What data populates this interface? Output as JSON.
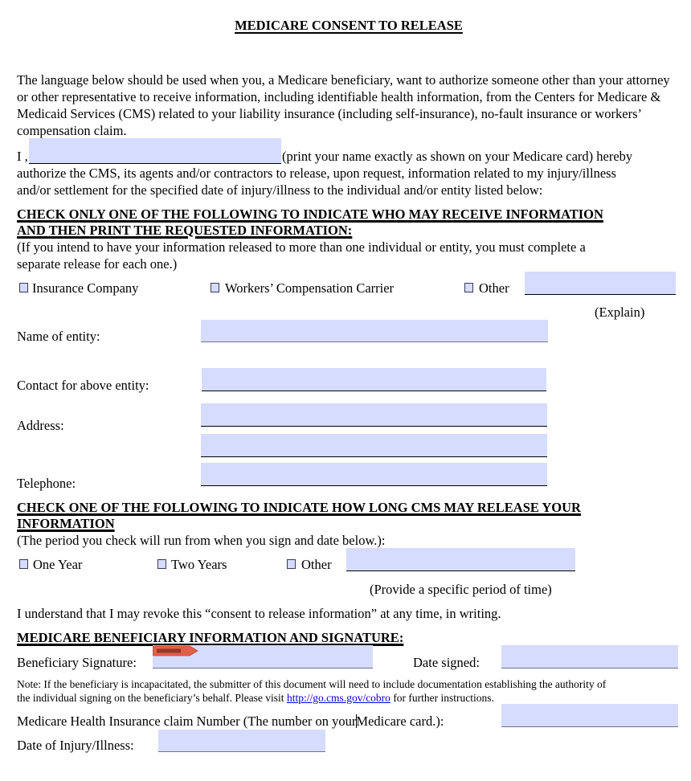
{
  "document": {
    "title": "MEDICARE CONSENT TO RELEASE",
    "intro": "The language below should be used when you, a Medicare beneficiary, want to authorize someone other than your attorney or other representative to receive information, including identifiable health information, from the Centers for Medicare & Medicaid Services (CMS) related to your liability insurance (including self-insurance), no-fault insurance or workers’ compensation claim.",
    "authorization": {
      "prefix": "I ,",
      "after_name": "(print your name exactly as shown on your Medicare card) hereby",
      "line2": "authorize the CMS, its agents and/or contractors to release, upon request, information related to my injury/illness",
      "line3": "and/or settlement for the specified date of injury/illness to the individual and/or entity listed below:",
      "name_value": ""
    },
    "section_recipient": {
      "heading_line1": "CHECK ONLY ONE OF THE FOLLOWING TO INDICATE WHO MAY RECEIVE INFORMATION",
      "heading_line2": "AND THEN PRINT THE REQUESTED INFORMATION:",
      "instructions_line1": "(If you intend to have your information released to more than one individual or entity, you must complete a",
      "instructions_line2": "separate release for each one.)",
      "options": [
        {
          "label": "Insurance Company",
          "checked": false
        },
        {
          "label": "Workers’ Compensation Carrier",
          "checked": false
        },
        {
          "label": "Other",
          "checked": false
        }
      ],
      "other_value": "",
      "other_hint": "(Explain)",
      "fields": {
        "entity_name_label": "Name of entity:",
        "contact_label": "Contact for above entity:",
        "address_label": "Address:",
        "telephone_label": "Telephone:"
      }
    },
    "section_duration": {
      "heading_line1": "CHECK ONE OF THE FOLLOWING TO INDICATE  HOW LONG CMS MAY RELEASE YOUR",
      "heading_line2": "INFORMATION",
      "instructions": "(The period you check will run from when you sign and date below.):",
      "options": [
        {
          "label": "One Year",
          "checked": false
        },
        {
          "label": "Two Years",
          "checked": false
        },
        {
          "label": "Other",
          "checked": false
        }
      ],
      "other_value": "",
      "other_hint": "(Provide a specific period of time)",
      "revoke_statement": "I understand that I may revoke this “consent to release information” at any time, in writing."
    },
    "section_signature": {
      "heading": "MEDICARE BENEFICIARY INFORMATION AND SIGNATURE:",
      "signature_label": "Beneficiary Signature:",
      "sign_here_tag": "SIGN HERE",
      "date_label": "Date signed:",
      "note_line1": "Note: If the beneficiary is incapacitated, the submitter of this document will need to include documentation establishing the authority of",
      "note_line2_prefix": "the individual signing on the beneficiary’s behalf. Please visit ",
      "note_link": "http://go.cms.gov/cobro",
      "note_line2_suffix": " for further instructions.",
      "claim_label_part1": "Medicare Health Insurance claim Number (The number on your",
      "claim_label_part2": "Medicare card.):",
      "injury_date_label": "Date of Injury/Illness:"
    }
  },
  "colors": {
    "field_fill": "#d6dcfd",
    "link": "#0000ee",
    "sign_tag": "#e0604a"
  }
}
